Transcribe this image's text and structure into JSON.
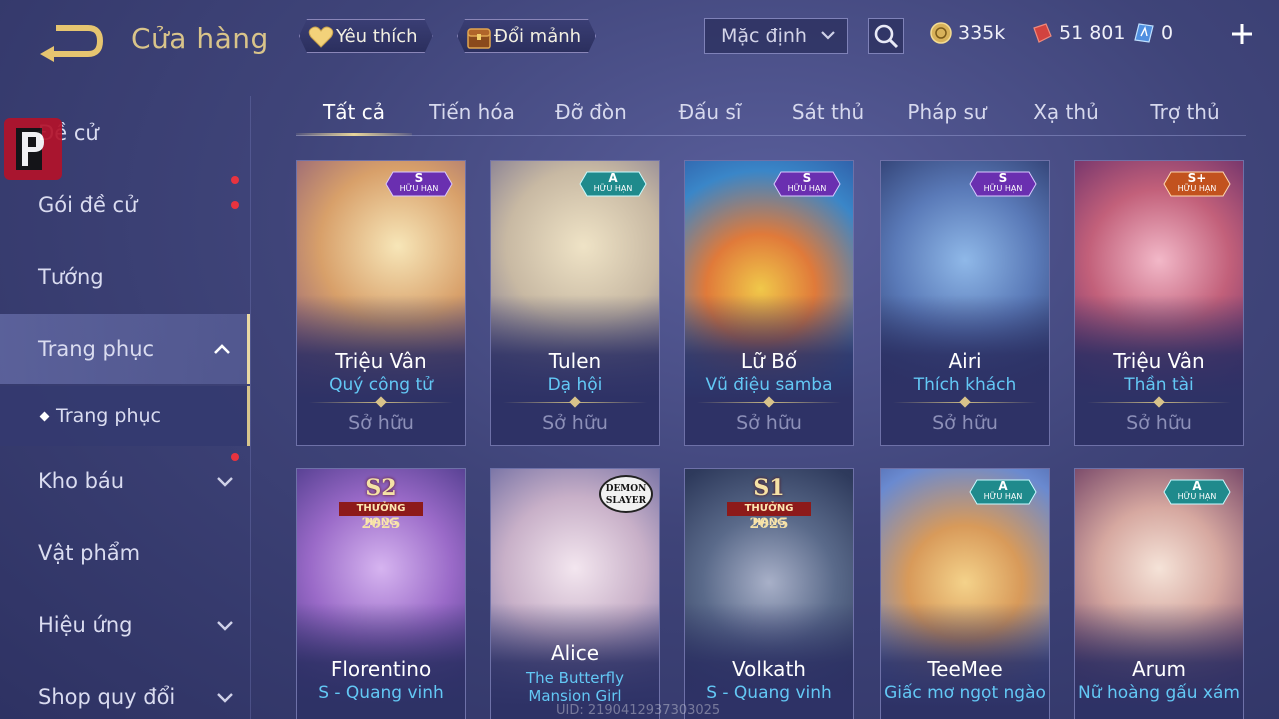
{
  "header": {
    "title": "Cửa hàng",
    "favorites_label": "Yêu thích",
    "exchange_label": "Đổi mảnh",
    "sort": {
      "selected": "Mặc định"
    },
    "currencies": [
      {
        "icon": "gold-coin-icon",
        "value": "335k"
      },
      {
        "icon": "red-voucher-icon",
        "value": "51 801"
      },
      {
        "icon": "blue-crystal-icon",
        "value": "0"
      }
    ]
  },
  "sidebar": {
    "items": [
      {
        "label": "Đề cử"
      },
      {
        "label": "Gói đề cử",
        "notify": true
      },
      {
        "label": "Tướng"
      },
      {
        "label": "Trang phục",
        "expanded": true
      },
      {
        "label": "Trang phục"
      },
      {
        "label": "Kho báu",
        "notify": true
      },
      {
        "label": "Vật phẩm"
      },
      {
        "label": "Hiệu ứng"
      },
      {
        "label": "Shop quy đổi"
      }
    ]
  },
  "tabs": [
    "Tất cả",
    "Tiến hóa",
    "Đỡ đòn",
    "Đấu sĩ",
    "Sát thủ",
    "Pháp sư",
    "Xạ thủ",
    "Trợ thủ"
  ],
  "tier_sub": "HỮU HẠN",
  "cards": [
    {
      "hero": "Triệu Vân",
      "skin": "Quý công tử",
      "status": "Sở hữu",
      "tier": "S",
      "badge_color": "#6a2fb0"
    },
    {
      "hero": "Tulen",
      "skin": "Dạ hội",
      "status": "Sở hữu",
      "tier": "A",
      "badge_color": "#1f8a8c"
    },
    {
      "hero": "Lữ Bố",
      "skin": "Vũ điệu samba",
      "status": "Sở hữu",
      "tier": "S",
      "badge_color": "#6a2fb0"
    },
    {
      "hero": "Airi",
      "skin": "Thích khách",
      "status": "Sở hữu",
      "tier": "S",
      "badge_color": "#6a2fb0"
    },
    {
      "hero": "Triệu Vân",
      "skin": "Thần tài",
      "status": "Sở hữu",
      "tier": "S+",
      "badge_color": "#c2521e"
    },
    {
      "hero": "Florentino",
      "skin": "S - Quang vinh",
      "rank": {
        "season": "S2",
        "label": "THƯỞNG HẠNG",
        "year": "2025"
      }
    },
    {
      "hero": "Alice",
      "skin": "The Butterfly Mansion Girl",
      "collab": "DEMON SLAYER"
    },
    {
      "hero": "Volkath",
      "skin": "S - Quang vinh",
      "rank": {
        "season": "S1",
        "label": "THƯỞNG HẠNG",
        "year": "2025"
      }
    },
    {
      "hero": "TeeMee",
      "skin": "Giấc mơ ngọt ngào",
      "tier": "A",
      "badge_color": "#1f8a8c"
    },
    {
      "hero": "Arum",
      "skin": "Nữ hoàng gấu xám",
      "tier": "A",
      "badge_color": "#1f8a8c"
    }
  ],
  "uid": "UID: 2190412937303025"
}
